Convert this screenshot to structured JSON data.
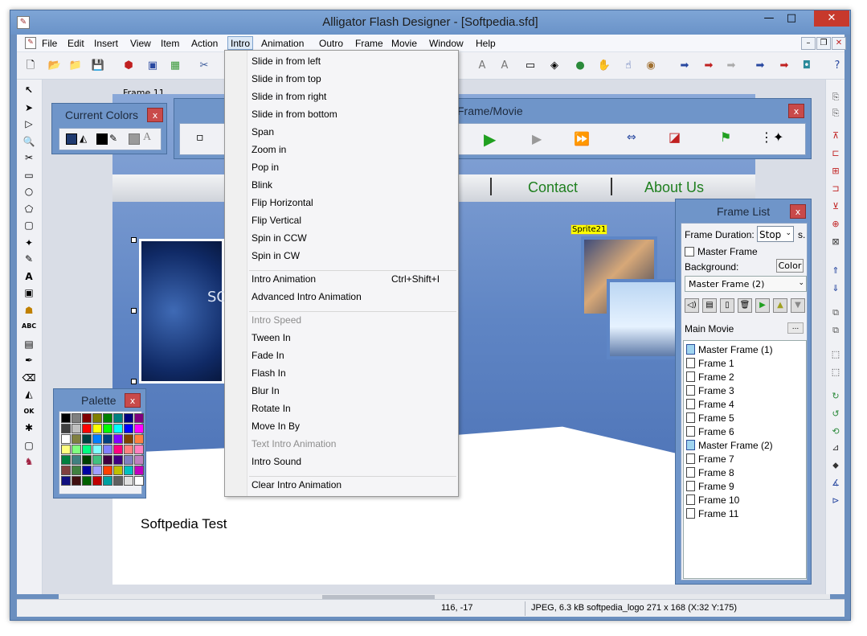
{
  "window": {
    "title": "Alligator Flash Designer - [Softpedia.sfd]",
    "minimize": "—",
    "maximize": "□",
    "close": "✕"
  },
  "menu": {
    "items": [
      "File",
      "Edit",
      "Insert",
      "View",
      "Item",
      "Action",
      "Intro",
      "Animation",
      "Outro",
      "Frame",
      "Movie",
      "Window",
      "Help"
    ],
    "active": "Intro"
  },
  "intro_menu": {
    "groups": [
      [
        "Slide in from left",
        "Slide in from top",
        "Slide in from right",
        "Slide in from bottom",
        "Span",
        "Zoom in",
        "Pop in",
        "Blink",
        "Flip Horizontal",
        "Flip Vertical",
        "Spin in CCW",
        "Spin in CW"
      ],
      [
        "Intro Animation",
        "Advanced Intro Animation"
      ],
      [
        "Intro Speed",
        "Tween In",
        "Fade In",
        "Flash In",
        "Blur In",
        "Rotate In",
        "Move In By",
        "Text Intro Animation",
        "Intro Sound"
      ],
      [
        "Clear Intro Animation"
      ]
    ],
    "shortcut": "Ctrl+Shift+I",
    "disabled": [
      "Intro Speed",
      "Text Intro Animation"
    ]
  },
  "workspace": {
    "frame_label": "Frame 11",
    "sprite_label": "Sprite21",
    "nav_links": [
      "Contact",
      "About Us"
    ],
    "photo_text": "SO",
    "stage_text": "Softpedia Test"
  },
  "current_colors": {
    "title": "Current Colors",
    "close": "x"
  },
  "frame_movie": {
    "title": "Frame/Movie",
    "close": "x"
  },
  "palette": {
    "title": "Palette",
    "close": "x",
    "colors": [
      "#000000",
      "#808080",
      "#800000",
      "#808000",
      "#008000",
      "#008080",
      "#000080",
      "#800080",
      "#404040",
      "#c0c0c0",
      "#ff0000",
      "#ffff00",
      "#00ff00",
      "#00ffff",
      "#0000ff",
      "#ff00ff",
      "#ffffff",
      "#808040",
      "#004040",
      "#0080ff",
      "#004080",
      "#8000ff",
      "#804000",
      "#ff8040",
      "#ffff80",
      "#80ff80",
      "#00ff80",
      "#80ffff",
      "#8080ff",
      "#ff0080",
      "#ff8080",
      "#ff80c0",
      "#008040",
      "#408080",
      "#004000",
      "#40c080",
      "#400040",
      "#400080",
      "#8080c0",
      "#c080c0",
      "#804040",
      "#408040",
      "#0000a0",
      "#a0a0ff",
      "#ff4000",
      "#c0c000",
      "#00c0c0",
      "#c000c0",
      "#101080",
      "#401010",
      "#006000",
      "#c00000",
      "#00a0a0",
      "#606060",
      "#e0e0e0",
      "#ffffff"
    ]
  },
  "frame_list": {
    "title": "Frame List",
    "close": "x",
    "frame_duration_label": "Frame Duration:",
    "frame_duration_value": "Stop",
    "seconds_label": "s.",
    "master_frame_label": "Master Frame",
    "background_label": "Background:",
    "color_button": "Color",
    "background_select": "Master Frame (2)",
    "main_movie_label": "Main Movie",
    "main_movie_button": "...",
    "frames": [
      "Master Frame (1)",
      "Frame 1",
      "Frame 2",
      "Frame 3",
      "Frame 4",
      "Frame 5",
      "Frame 6",
      "Master Frame (2)",
      "Frame 7",
      "Frame 8",
      "Frame 9",
      "Frame 10",
      "Frame 11"
    ]
  },
  "status": {
    "coords": "116, -17",
    "info": "JPEG, 6.3 kB softpedia_logo 271 x 168 (X:32 Y:175)"
  },
  "colors": {
    "window_frame": "#6b8fbf",
    "menu_highlight": "#dce8f6",
    "nav_link": "#1f7f1f",
    "close_red": "#c7392c",
    "sprite_label": "#ffff00",
    "play_green": "#20a020"
  }
}
